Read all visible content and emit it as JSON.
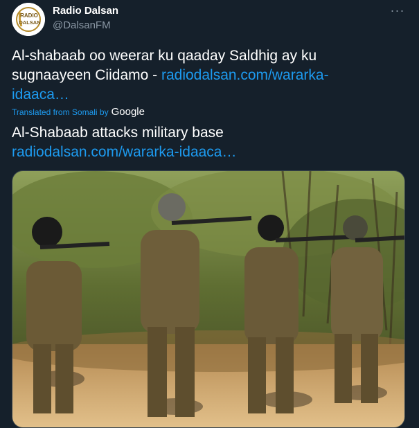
{
  "account": {
    "display_name": "Radio Dalsan",
    "handle": "@DalsanFM",
    "avatar_icon": "radio-dalsan-logo"
  },
  "more_icon": "more-horizontal-icon",
  "tweet": {
    "original_text_line1": "Al-shabaab oo weerar ku qaaday Saldhig ay ku",
    "original_text_line2_prefix": "sugnaayeen Ciidamo - ",
    "original_link_part1": "radiodalsan.com/wararka-",
    "original_link_part2": "idaaca…",
    "translated_from": "Translated from Somali by",
    "translator": "Google",
    "translated_text": "Al-Shabaab attacks military base",
    "translated_link": "radiodalsan.com/wararka-idaaca…"
  },
  "media": {
    "description_icon": "photo-soldiers-image"
  },
  "colors": {
    "background": "#15202b",
    "text": "#ffffff",
    "secondary": "#8b98a5",
    "link": "#1d9bf0"
  }
}
